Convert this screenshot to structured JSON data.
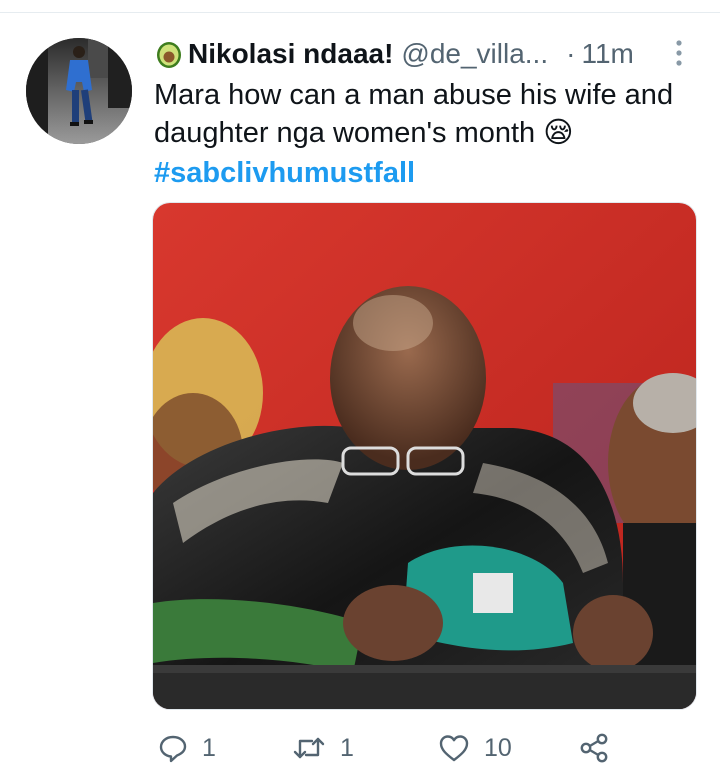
{
  "tweet": {
    "author": {
      "emoji": "🥑",
      "display_name": "Nikolasi ndaaa!",
      "handle": "@de_villa...",
      "avatar_icon": "person-walking-photo"
    },
    "separator": "·",
    "time": "11m",
    "text": "Mara how can a man abuse his wife and daughter nga women's month 😪",
    "hashtag": "#sabclivhumustfall",
    "media_description_icon": "photo",
    "actions": {
      "reply_count": "1",
      "retweet_count": "1",
      "like_count": "10"
    }
  },
  "colors": {
    "link": "#1d9bf0",
    "secondary": "#536471",
    "text": "#0f1419"
  }
}
